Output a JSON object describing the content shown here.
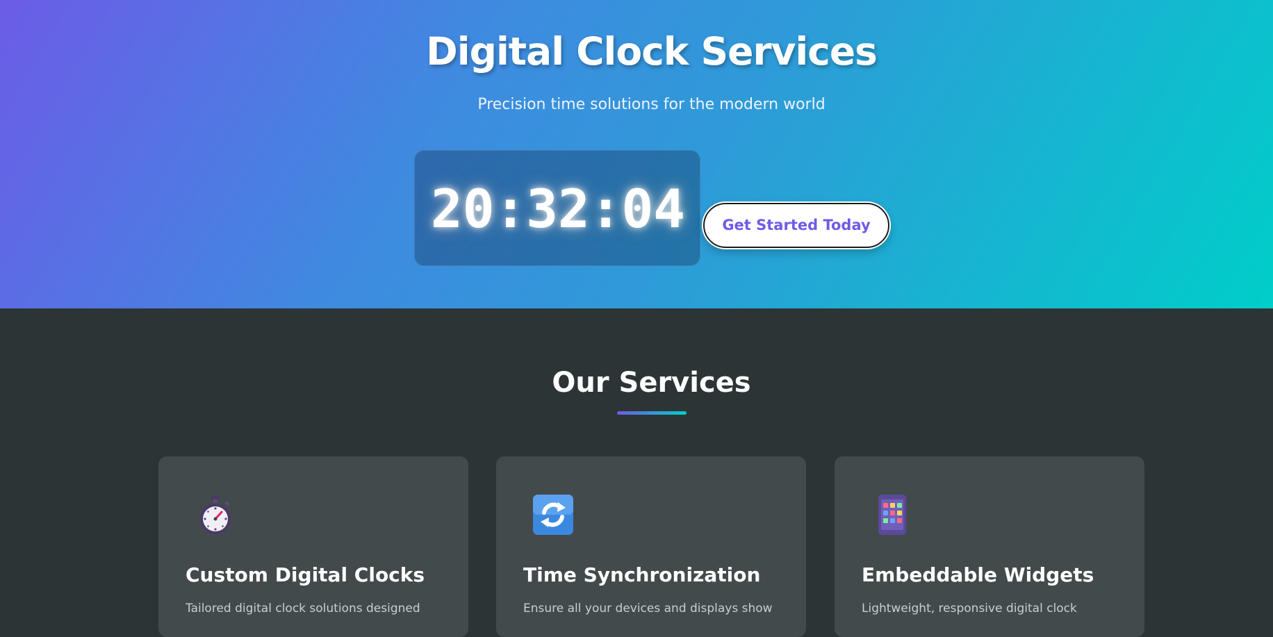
{
  "hero": {
    "title": "Digital Clock Services",
    "subtitle": "Precision time solutions for the modern world",
    "clock_time": "20:32:04",
    "cta_label": "Get Started Today"
  },
  "services": {
    "title": "Our Services",
    "cards": [
      {
        "icon": "stopwatch-icon",
        "title": "Custom Digital Clocks",
        "desc": "Tailored digital clock solutions designed"
      },
      {
        "icon": "sync-arrows-icon",
        "title": "Time Synchronization",
        "desc": "Ensure all your devices and displays show"
      },
      {
        "icon": "mobile-app-icon",
        "title": "Embeddable Widgets",
        "desc": "Lightweight, responsive digital clock"
      }
    ]
  },
  "colors": {
    "gradient_start": "#6c5ce7",
    "gradient_end": "#00cec9",
    "dark_bg": "#2d3436",
    "card_bg": "#434a4c",
    "cta_text": "#6c5ce7"
  }
}
